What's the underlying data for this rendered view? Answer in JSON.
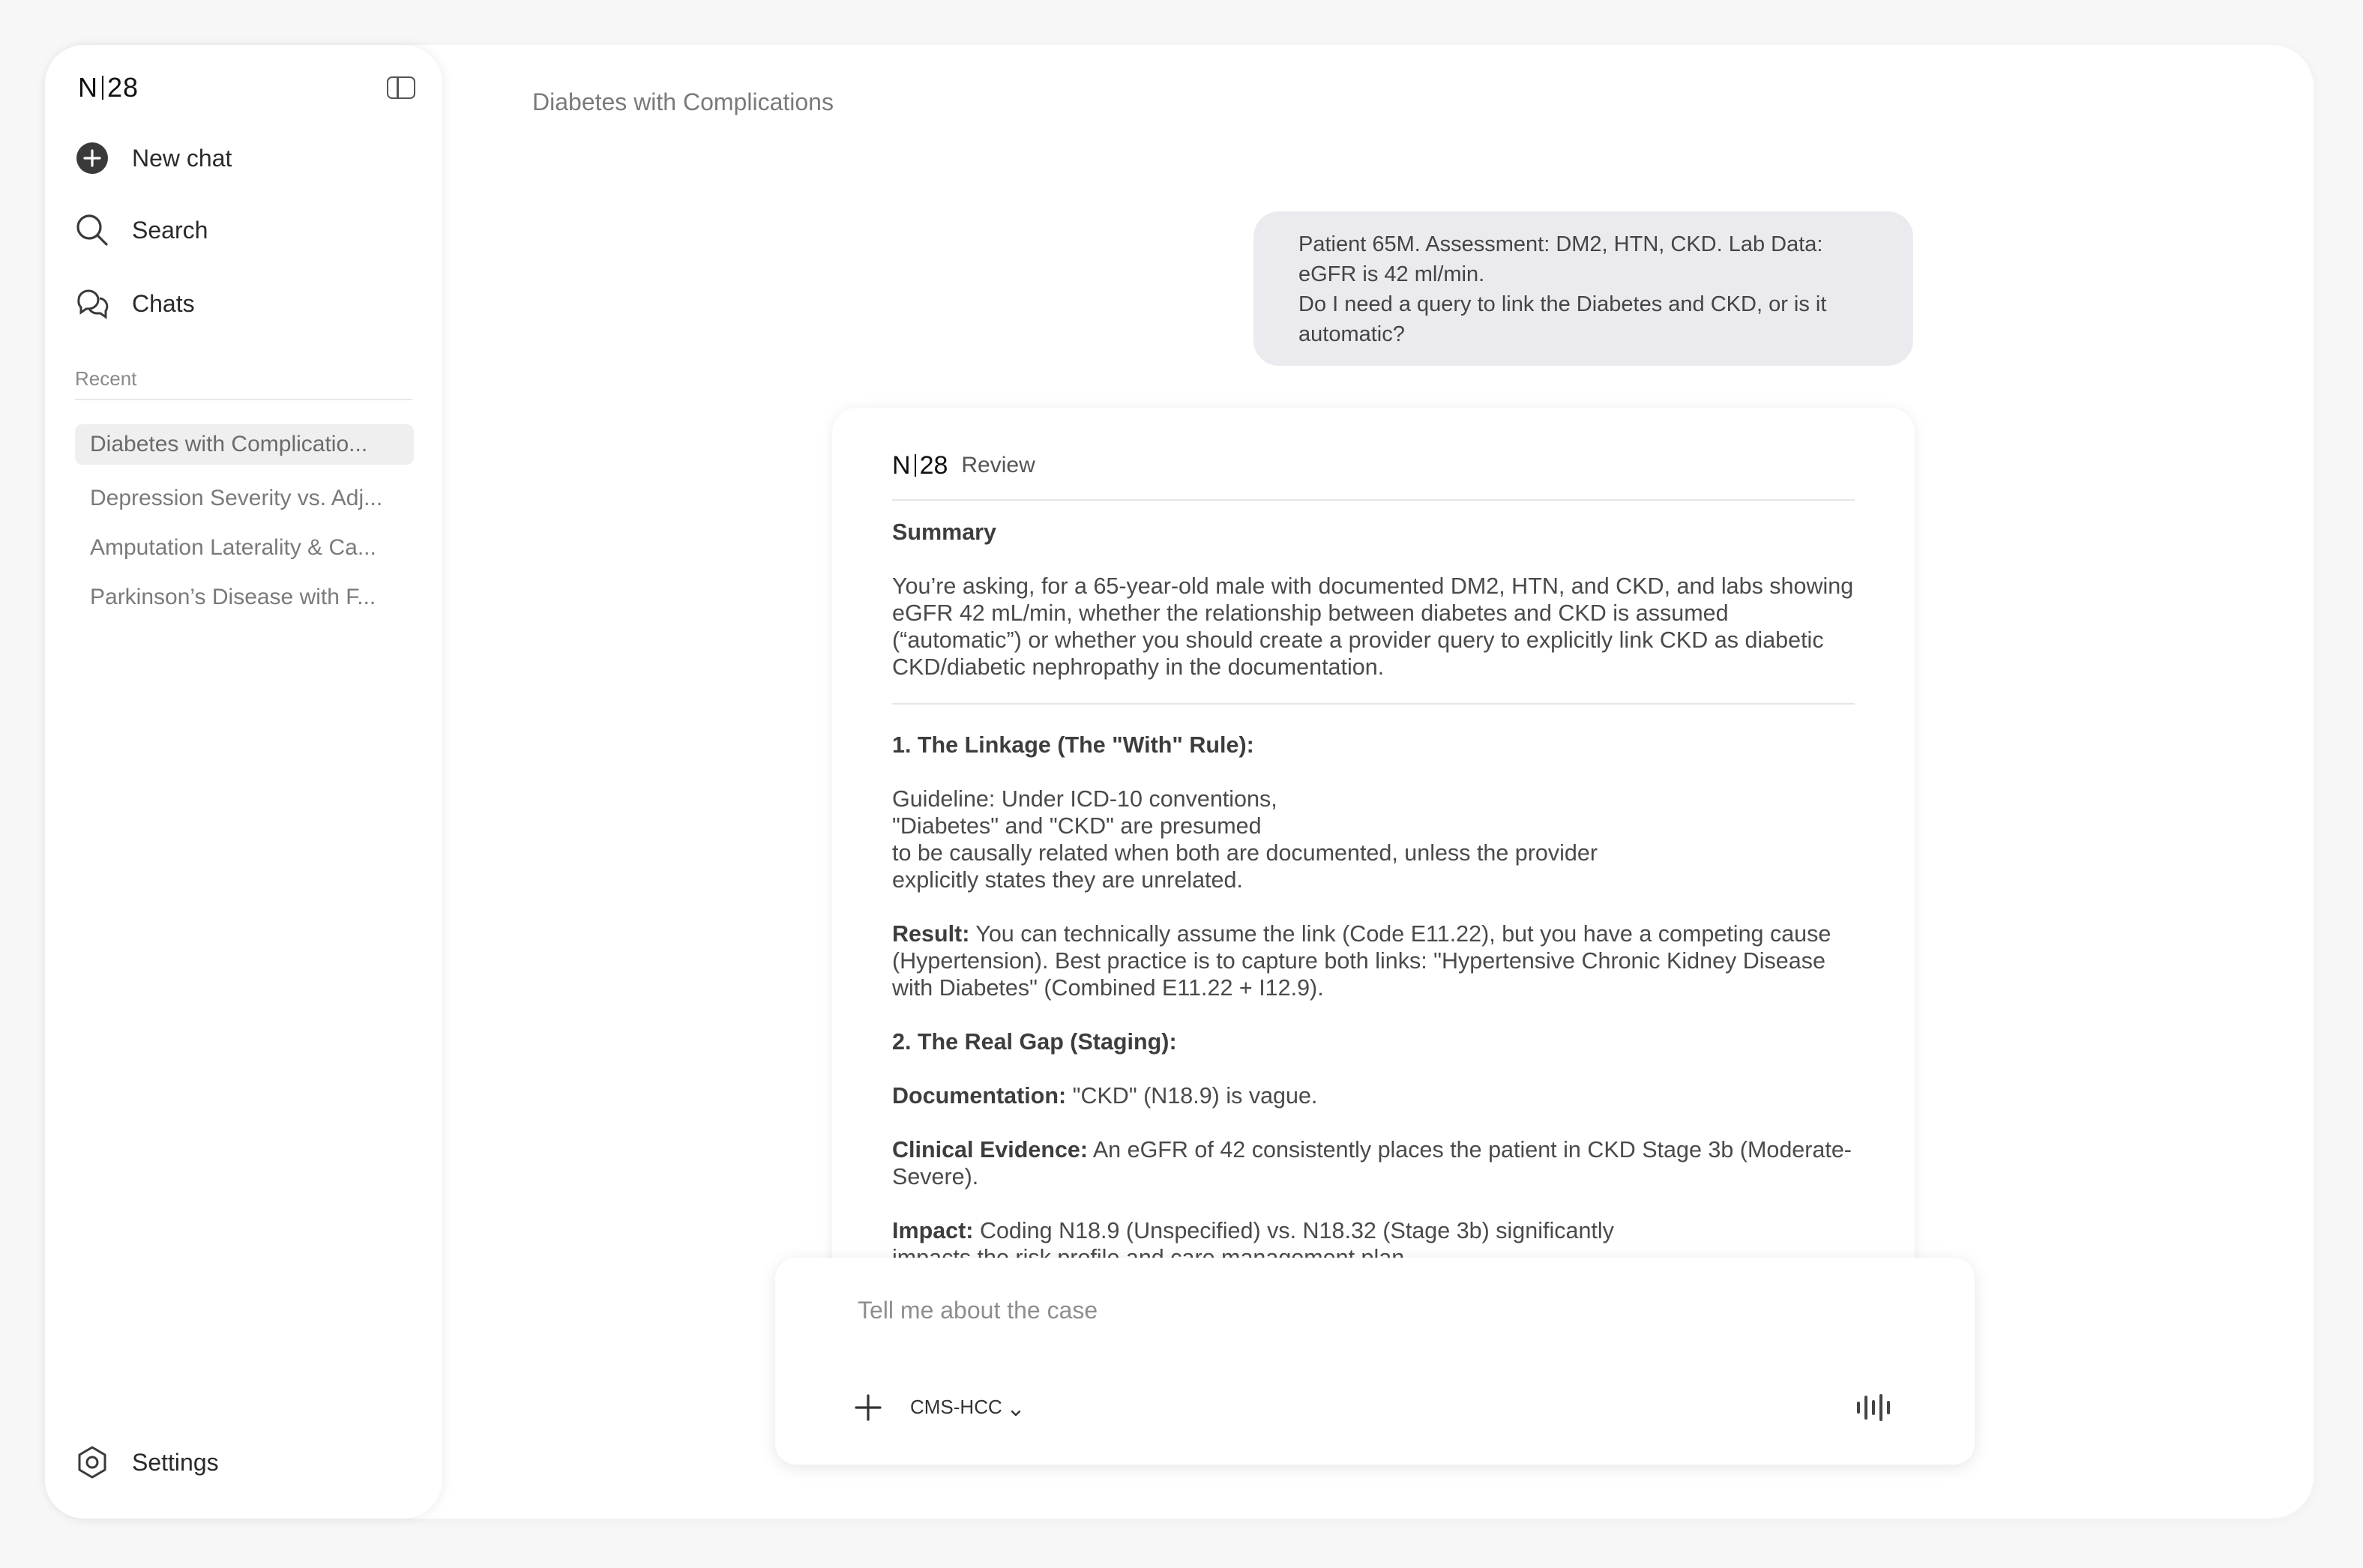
{
  "sidebar": {
    "logo": {
      "left": "N",
      "right": "28"
    },
    "nav": {
      "new_chat": "New chat",
      "search": "Search",
      "chats": "Chats"
    },
    "recent_label": "Recent",
    "recent_items": [
      {
        "label": "Diabetes with Complicatio...",
        "active": true
      },
      {
        "label": "Depression Severity vs. Adj...",
        "active": false
      },
      {
        "label": "Amputation Laterality & Ca...",
        "active": false
      },
      {
        "label": "Parkinson’s Disease with F...",
        "active": false
      }
    ],
    "settings": "Settings"
  },
  "main": {
    "title": "Diabetes with Complications",
    "user_message": {
      "line1": "Patient 65M. Assessment: DM2, HTN, CKD. Lab Data:",
      "line2": "eGFR is 42 ml/min.",
      "line3": "Do I need a query to link the Diabetes and CKD, or is it",
      "line4": "automatic?"
    },
    "answer": {
      "logo": {
        "left": "N",
        "right": "28"
      },
      "tag": "Review",
      "summary_heading": "Summary",
      "summary_text": "You’re asking, for a 65-year-old male with documented DM2, HTN, and CKD, and labs showing eGFR 42 mL/min, whether the relationship between diabetes and CKD is assumed (“automatic”) or whether you should create a provider query to explicitly link CKD as diabetic CKD/diabetic nephropathy in the documentation.",
      "section1_heading": "1. The Linkage (The \"With\" Rule):",
      "guideline_l1": "Guideline: Under ICD-10 conventions,",
      "guideline_l2": "\"Diabetes\" and \"CKD\" are presumed",
      "guideline_l3": "to be causally related when both are documented, unless the provider",
      "guideline_l4": "explicitly states they are unrelated.",
      "result_label": "Result:",
      "result_text": " You can technically assume the link (Code E11.22), but you have a competing cause (Hypertension). Best practice is to capture both links: \"Hypertensive Chronic Kidney Disease with Diabetes\" (Combined E11.22 + I12.9).",
      "section2_heading": "2. The Real Gap (Staging):",
      "documentation_label": "Documentation:",
      "documentation_text": " \"CKD\" (N18.9) is vague.",
      "clinical_label": "Clinical Evidence:",
      "clinical_text": " An eGFR of 42 consistently places the patient in CKD Stage 3b (Moderate-Severe).",
      "impact_label": "Impact:",
      "impact_text_l1": " Coding N18.9 (Unspecified) vs. N18.32 (Stage 3b) significantly",
      "impact_text_l2": "impacts the risk profile and care management plan."
    }
  },
  "composer": {
    "placeholder": "Tell me about the case",
    "model": "CMS-HCC"
  },
  "icons": {
    "new_chat": "plus-circle-icon",
    "search": "search-icon",
    "chats": "chat-bubbles-icon",
    "settings": "settings-gear-icon",
    "collapse": "sidebar-toggle-icon",
    "attach": "plus-icon",
    "voice": "voice-waveform-icon",
    "model_chevron": "chevron-down-icon"
  }
}
